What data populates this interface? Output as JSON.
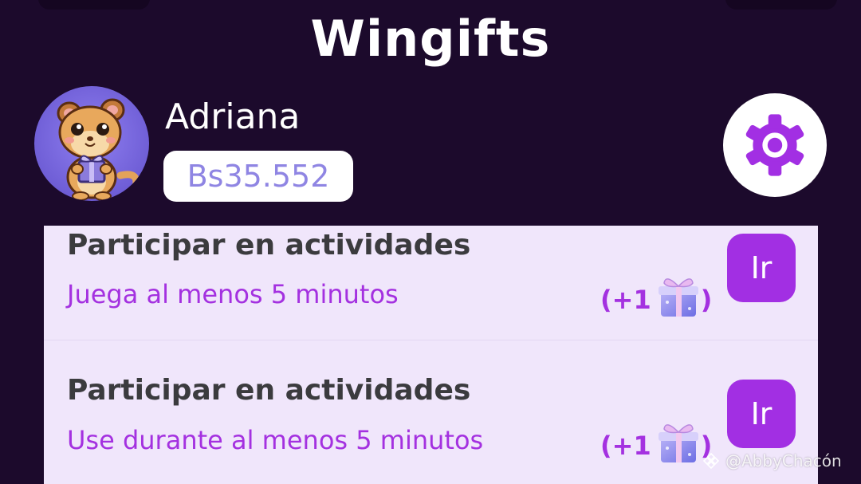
{
  "app": {
    "title": "Wingifts"
  },
  "user": {
    "name": "Adriana",
    "balance": "Bs35.552",
    "avatar_icon": "hamster-with-gift-avatar"
  },
  "header": {
    "settings_icon": "gear-icon"
  },
  "tasks": [
    {
      "title": "Participar en actividades",
      "subtitle": "Juega al menos 5 minutos",
      "reward_prefix": "(+1",
      "reward_suffix": ")",
      "reward_icon": "gift-box-icon",
      "button_label": "Ir"
    },
    {
      "title": "Participar en actividades",
      "subtitle": "Use durante al menos 5 minutos",
      "reward_prefix": "(+1",
      "reward_suffix": ")",
      "reward_icon": "gift-box-icon",
      "button_label": "Ir"
    }
  ],
  "watermark": {
    "text": "@AbbyChacón"
  },
  "colors": {
    "background": "#1c0a2c",
    "accent": "#a22fe3",
    "panel": "#f0e6fb",
    "balance_text": "#8f85e3"
  }
}
